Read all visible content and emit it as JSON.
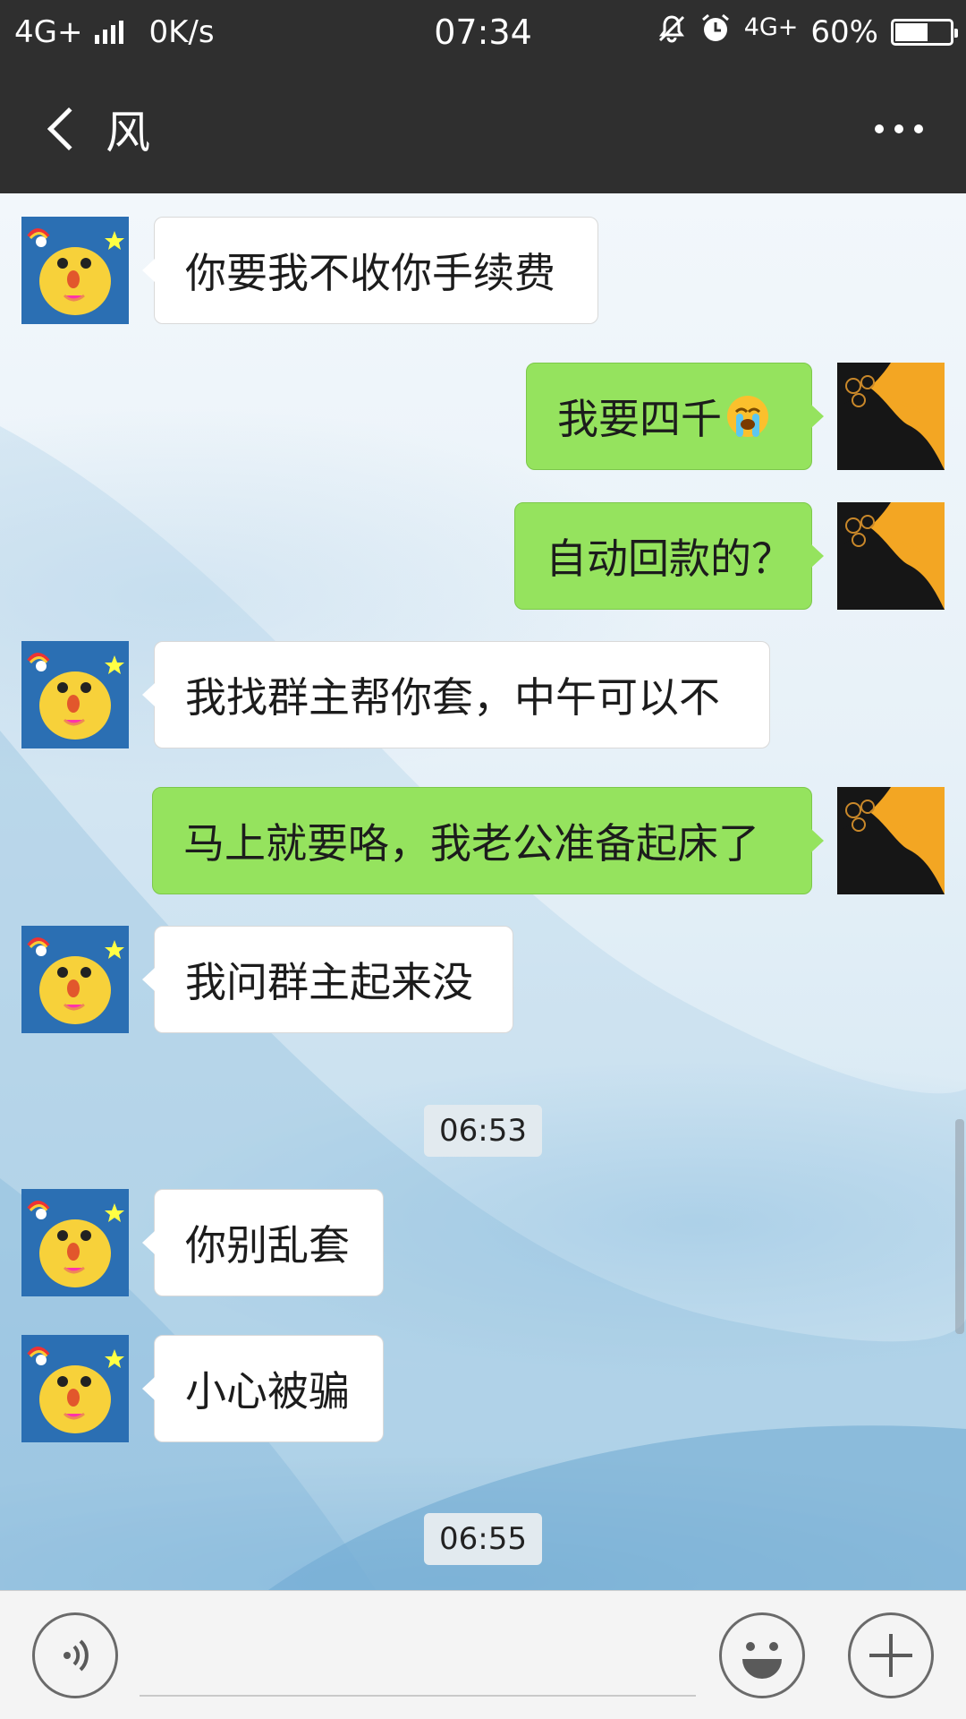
{
  "status_bar": {
    "network": "4G+",
    "speed": "0K/s",
    "time": "07:34",
    "network_right": "4G+",
    "battery": "60%",
    "battery_level": 0.6,
    "icons": [
      "signal-icon",
      "mute-icon",
      "alarm-icon",
      "battery-icon"
    ]
  },
  "header": {
    "title": "风",
    "back_icon": "chevron-left-icon",
    "more_icon": "more-dots-icon"
  },
  "messages": [
    {
      "side": "in",
      "text": "你要我不收你手续费"
    },
    {
      "side": "out",
      "text": "我要四千",
      "emoji": "crying-face-emoji"
    },
    {
      "side": "out",
      "text": "自动回款的？"
    },
    {
      "side": "in",
      "text": "我找群主帮你套，中午可以不"
    },
    {
      "side": "out",
      "text": "马上就要咯，我老公准备起床了"
    },
    {
      "side": "in",
      "text": "我问群主起来没"
    },
    {
      "type": "time",
      "text": "06:53"
    },
    {
      "side": "in",
      "text": "你别乱套"
    },
    {
      "side": "in",
      "text": "小心被骗"
    },
    {
      "type": "time",
      "text": "06:55"
    }
  ],
  "input_bar": {
    "voice_icon": "voice-icon",
    "emoji_icon": "smiley-icon",
    "plus_icon": "plus-icon",
    "input_value": ""
  },
  "colors": {
    "bar_bg": "#2f2f2f",
    "bubble_out": "#95e35e",
    "bubble_in": "#ffffff",
    "input_bg": "#f4f4f4"
  }
}
